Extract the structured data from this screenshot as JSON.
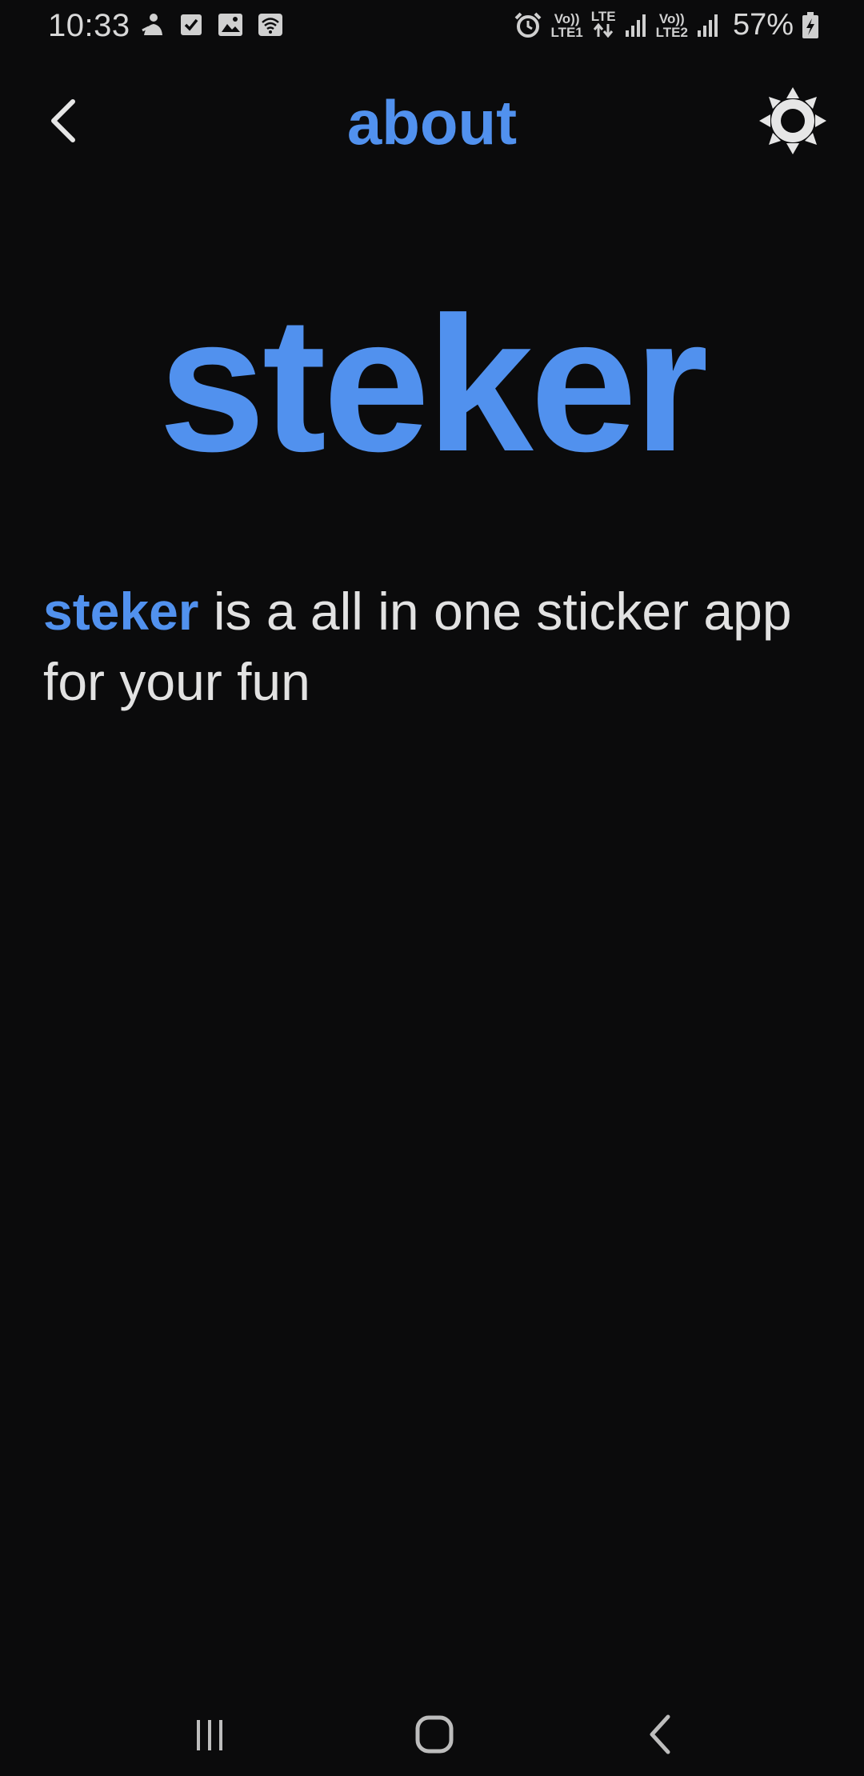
{
  "status_bar": {
    "time": "10:33",
    "battery_percent": "57%",
    "sim1_top": "Vo))",
    "sim1_bottom": "LTE1",
    "lte_label": "LTE",
    "sim2_top": "Vo))",
    "sim2_bottom": "LTE2",
    "icons": [
      "notification-icon",
      "checkbox-icon",
      "image-icon",
      "wifi-icon",
      "alarm-icon",
      "data-arrows-icon",
      "signal-icon",
      "signal-icon",
      "battery-charging-icon"
    ]
  },
  "app_bar": {
    "title": "about",
    "back_icon": "chevron-left-icon",
    "theme_icon": "sun-icon"
  },
  "content": {
    "brand_title": "steker",
    "description_brand": "steker",
    "description_text": " is a all in one sticker app for your fun"
  },
  "nav_bar": {
    "icons": [
      "recents-icon",
      "home-icon",
      "back-icon"
    ]
  },
  "colors": {
    "accent": "#5191ee",
    "background": "#0b0b0c",
    "text": "#e2e2e2"
  }
}
